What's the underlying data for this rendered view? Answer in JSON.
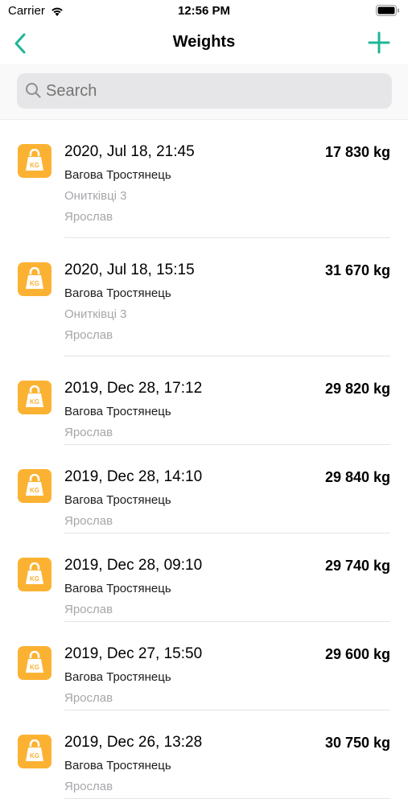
{
  "status": {
    "carrier": "Carrier",
    "time": "12:56 PM"
  },
  "nav": {
    "title": "Weights"
  },
  "search": {
    "placeholder": "Search"
  },
  "colors": {
    "accent": "#1db597",
    "badge": "#fbb233"
  },
  "badge_text": "KG",
  "items": [
    {
      "date": "2020, Jul 18, 21:45",
      "weight": "17 830 kg",
      "lines": [
        "Вагова Тростянець",
        "Онитківці 3",
        "Ярослав"
      ]
    },
    {
      "date": "2020, Jul 18, 15:15",
      "weight": "31 670 kg",
      "lines": [
        "Вагова Тростянець",
        "Онитківці 3",
        "Ярослав"
      ]
    },
    {
      "date": "2019, Dec 28, 17:12",
      "weight": "29 820 kg",
      "lines": [
        "Вагова Тростянець",
        "Ярослав"
      ]
    },
    {
      "date": "2019, Dec 28, 14:10",
      "weight": "29 840 kg",
      "lines": [
        "Вагова Тростянець",
        "Ярослав"
      ]
    },
    {
      "date": "2019, Dec 28, 09:10",
      "weight": "29 740 kg",
      "lines": [
        "Вагова Тростянець",
        "Ярослав"
      ]
    },
    {
      "date": "2019, Dec 27, 15:50",
      "weight": "29 600 kg",
      "lines": [
        "Вагова Тростянець",
        "Ярослав"
      ]
    },
    {
      "date": "2019, Dec 26, 13:28",
      "weight": "30 750 kg",
      "lines": [
        "Вагова Тростянець",
        "Ярослав"
      ]
    }
  ]
}
